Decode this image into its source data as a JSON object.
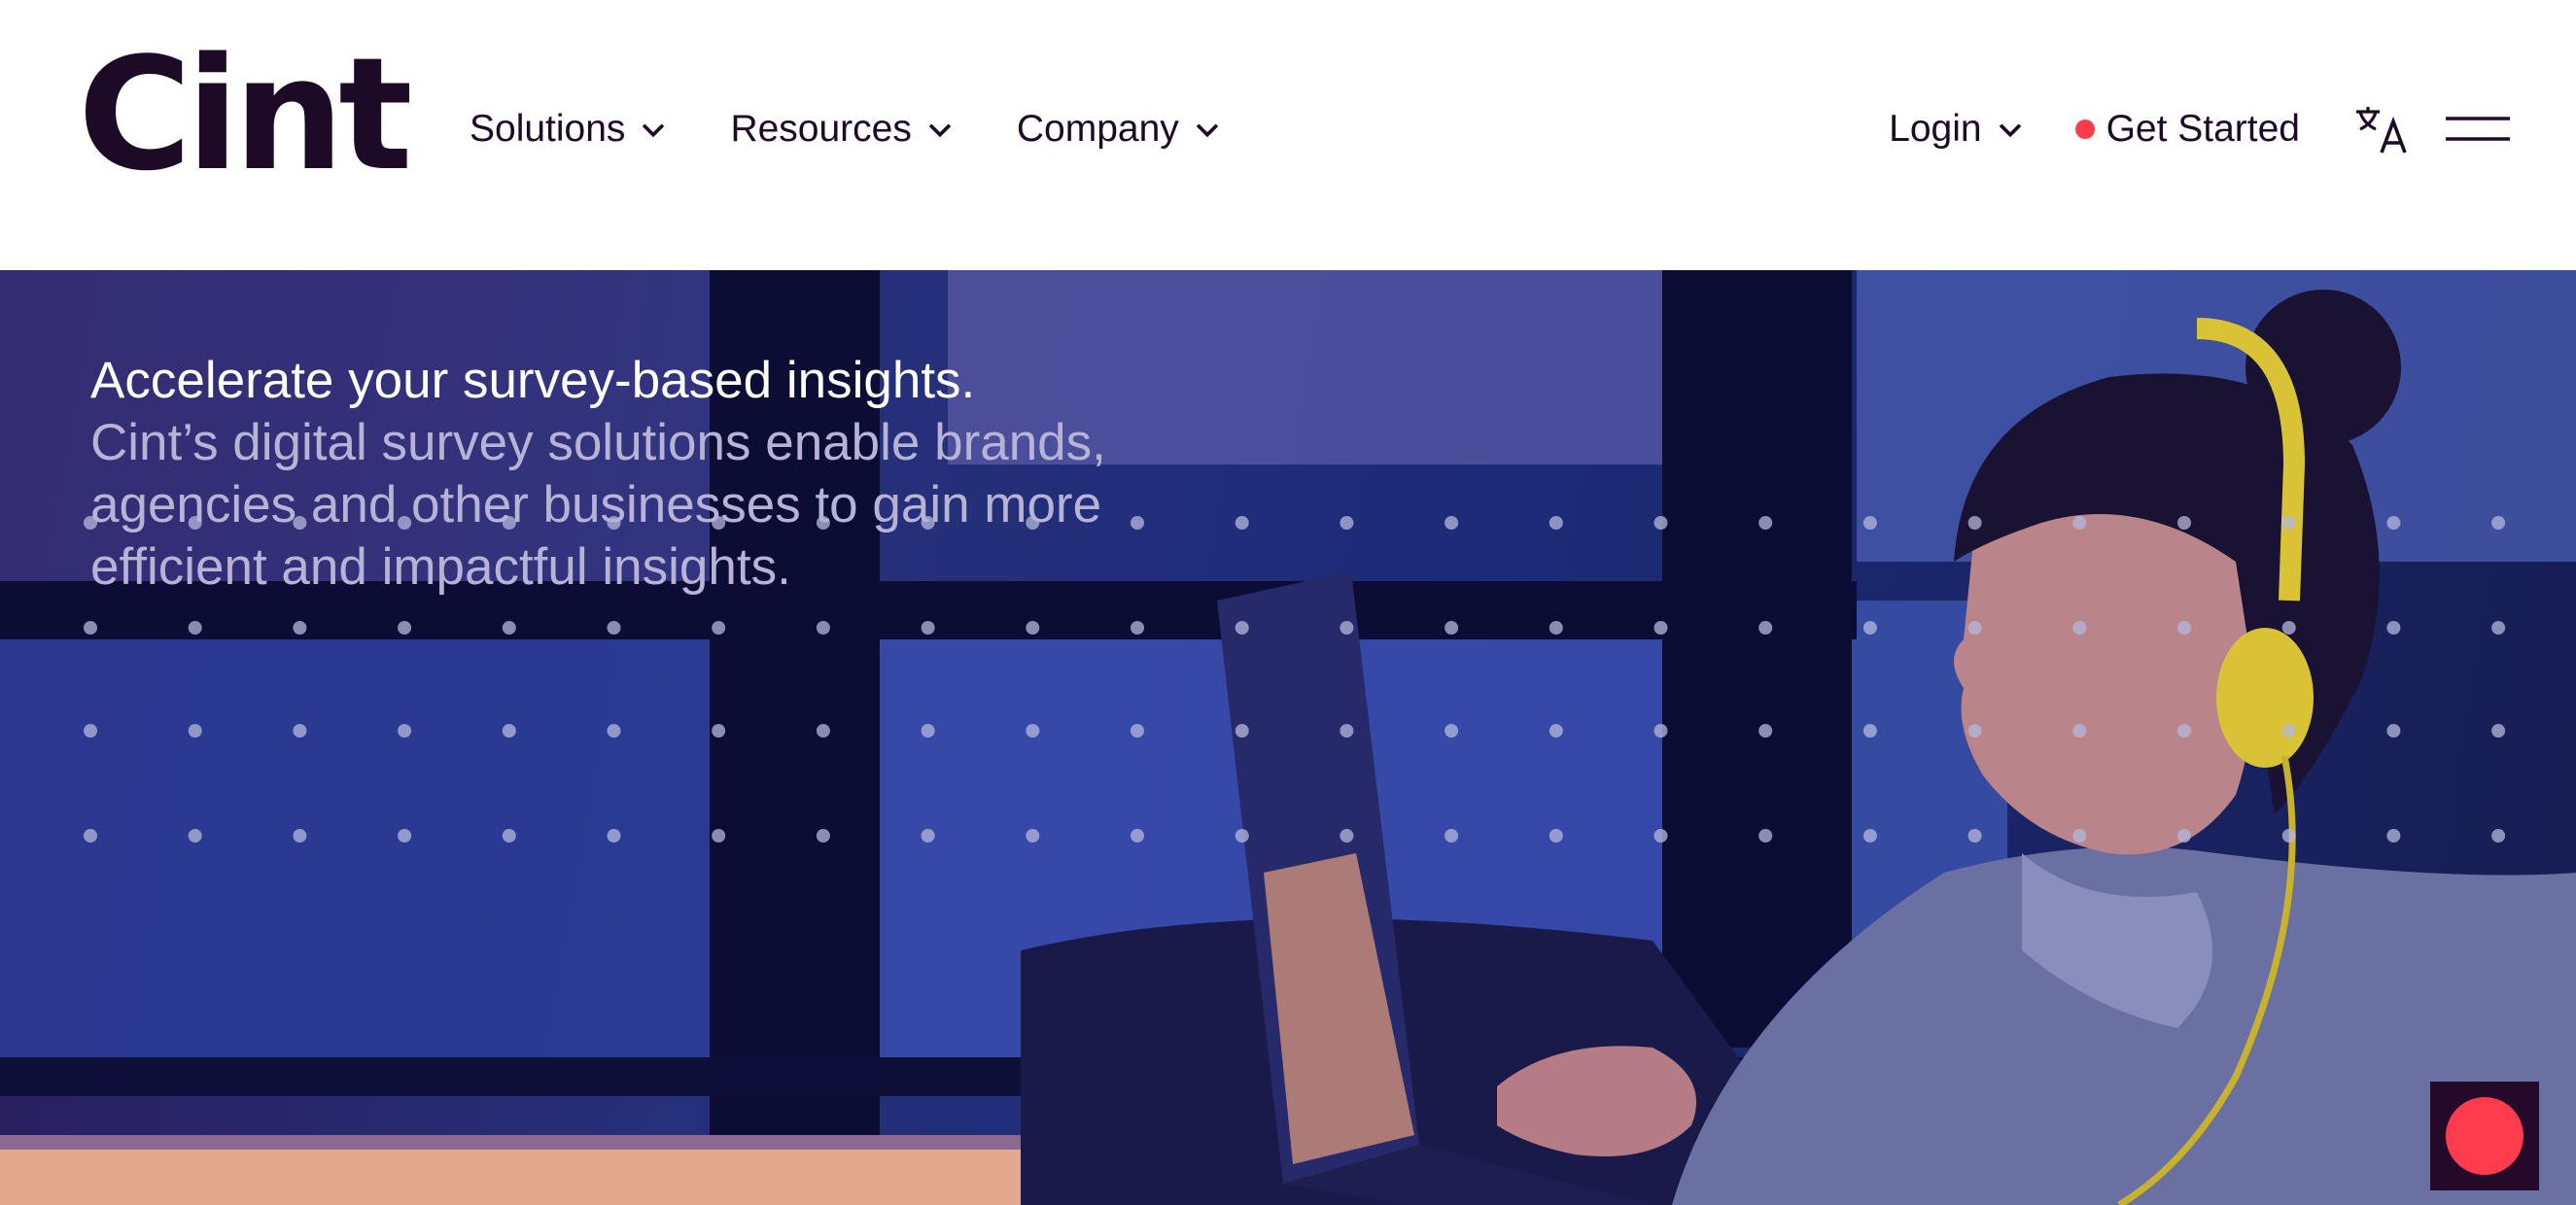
{
  "header": {
    "logo_text": "Cint",
    "nav": [
      {
        "label": "Solutions",
        "icon": "chevron-down-icon"
      },
      {
        "label": "Resources",
        "icon": "chevron-down-icon"
      },
      {
        "label": "Company",
        "icon": "chevron-down-icon"
      }
    ],
    "login_label": "Login",
    "get_started_label": "Get Started",
    "translate_icon": "translate-icon",
    "menu_icon": "hamburger-menu-icon"
  },
  "hero": {
    "title": "Accelerate your survey-based insights.",
    "subtitle": "Cint’s digital survey solutions enable brands, agencies and other businesses to gain more efficient and impactful insights.",
    "image": "woman-with-headphones-using-laptop-at-night"
  },
  "chat": {
    "icon": "chat-launcher-icon"
  },
  "colors": {
    "brand_dark": "#1d0a26",
    "accent_red": "#ff3b4e",
    "hero_blue": "#1d2c78",
    "hero_text": "#ffffff",
    "hero_subtext": "#b6b3d6"
  }
}
